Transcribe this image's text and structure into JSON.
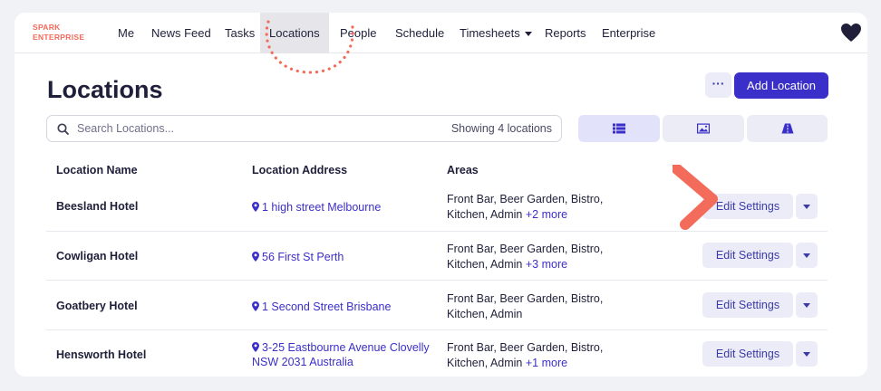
{
  "brand": {
    "line1": "SPARK",
    "line2": "ENTERPRISE"
  },
  "nav": {
    "items": [
      {
        "label": "Me"
      },
      {
        "label": "News Feed"
      },
      {
        "label": "Tasks"
      },
      {
        "label": "Locations",
        "active": true
      },
      {
        "label": "People"
      },
      {
        "label": "Schedule"
      },
      {
        "label": "Timesheets",
        "dropdown": true
      },
      {
        "label": "Reports"
      },
      {
        "label": "Enterprise"
      }
    ],
    "heart_icon": "heart-icon"
  },
  "page": {
    "title": "Locations",
    "more_label": "···",
    "add_label": "Add Location"
  },
  "search": {
    "placeholder": "Search Locations...",
    "value": "",
    "showing": "Showing 4 locations"
  },
  "views": [
    {
      "icon": "list-icon",
      "active": true
    },
    {
      "icon": "image-icon",
      "active": false
    },
    {
      "icon": "map-road-icon",
      "active": false
    }
  ],
  "table": {
    "headers": {
      "name": "Location Name",
      "address": "Location Address",
      "areas": "Areas"
    },
    "rows": [
      {
        "name": "Beesland Hotel",
        "address": "1 high street Melbourne",
        "areas": "Front Bar, Beer Garden, Bistro, Kitchen, Admin",
        "more": "+2 more",
        "edit": "Edit Settings"
      },
      {
        "name": "Cowligan Hotel",
        "address": "56 First St Perth",
        "areas": "Front Bar, Beer Garden, Bistro, Kitchen, Admin",
        "more": "+3 more",
        "edit": "Edit Settings"
      },
      {
        "name": "Goatbery Hotel",
        "address": "1 Second Street Brisbane",
        "areas": "Front Bar, Beer Garden, Bistro, Kitchen, Admin",
        "more": "",
        "edit": "Edit Settings"
      },
      {
        "name": "Hensworth Hotel",
        "address": "3-25 Eastbourne Avenue Clovelly NSW 2031 Australia",
        "areas": "Front Bar, Beer Garden, Bistro, Kitchen, Admin",
        "more": "+1 more",
        "edit": "Edit Settings"
      }
    ]
  },
  "colors": {
    "accent": "#3b2fc9",
    "brand": "#f26b5b",
    "highlight": "#f26b5b"
  }
}
